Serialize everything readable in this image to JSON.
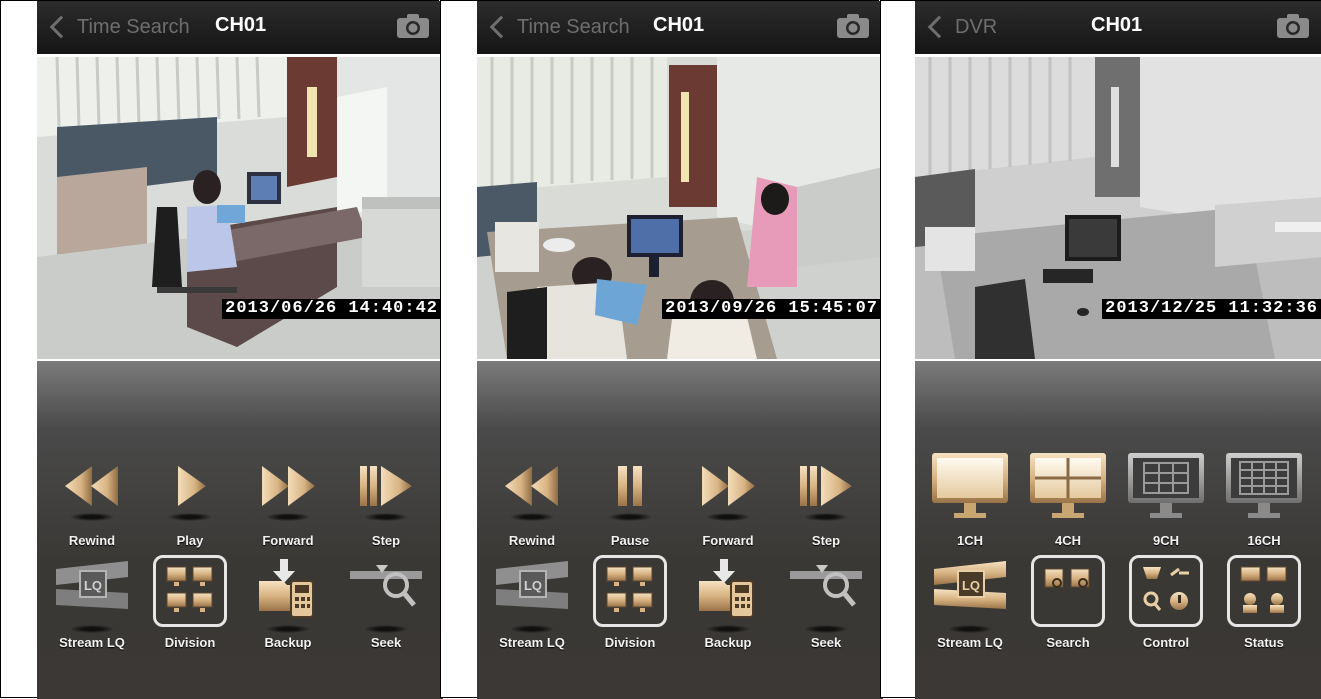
{
  "screens": [
    {
      "nav": {
        "back_label": "Time Search",
        "title": "CH01"
      },
      "timestamp": "2013/06/26 14:40:42",
      "row1": [
        "Rewind",
        "Play",
        "Forward",
        "Step"
      ],
      "row2": [
        "Stream LQ",
        "Division",
        "Backup",
        "Seek"
      ]
    },
    {
      "nav": {
        "back_label": "Time Search",
        "title": "CH01"
      },
      "timestamp": "2013/09/26 15:45:07",
      "row1": [
        "Rewind",
        "Pause",
        "Forward",
        "Step"
      ],
      "row2": [
        "Stream LQ",
        "Division",
        "Backup",
        "Seek"
      ]
    },
    {
      "nav": {
        "back_label": "DVR",
        "title": "CH01"
      },
      "timestamp": "2013/12/25 11:32:36",
      "row1": [
        "1CH",
        "4CH",
        "9CH",
        "16CH"
      ],
      "row2": [
        "Stream LQ",
        "Search",
        "Control",
        "Status"
      ]
    }
  ],
  "colors": {
    "gold": "#d8b383",
    "gold_dark": "#8a6a45",
    "gray_icon": "#9a9a9a",
    "panel": "#3b3835",
    "navbar": "#1c1c1c"
  },
  "icons": {
    "camera": "camera-icon",
    "back": "chevron-left-icon"
  }
}
